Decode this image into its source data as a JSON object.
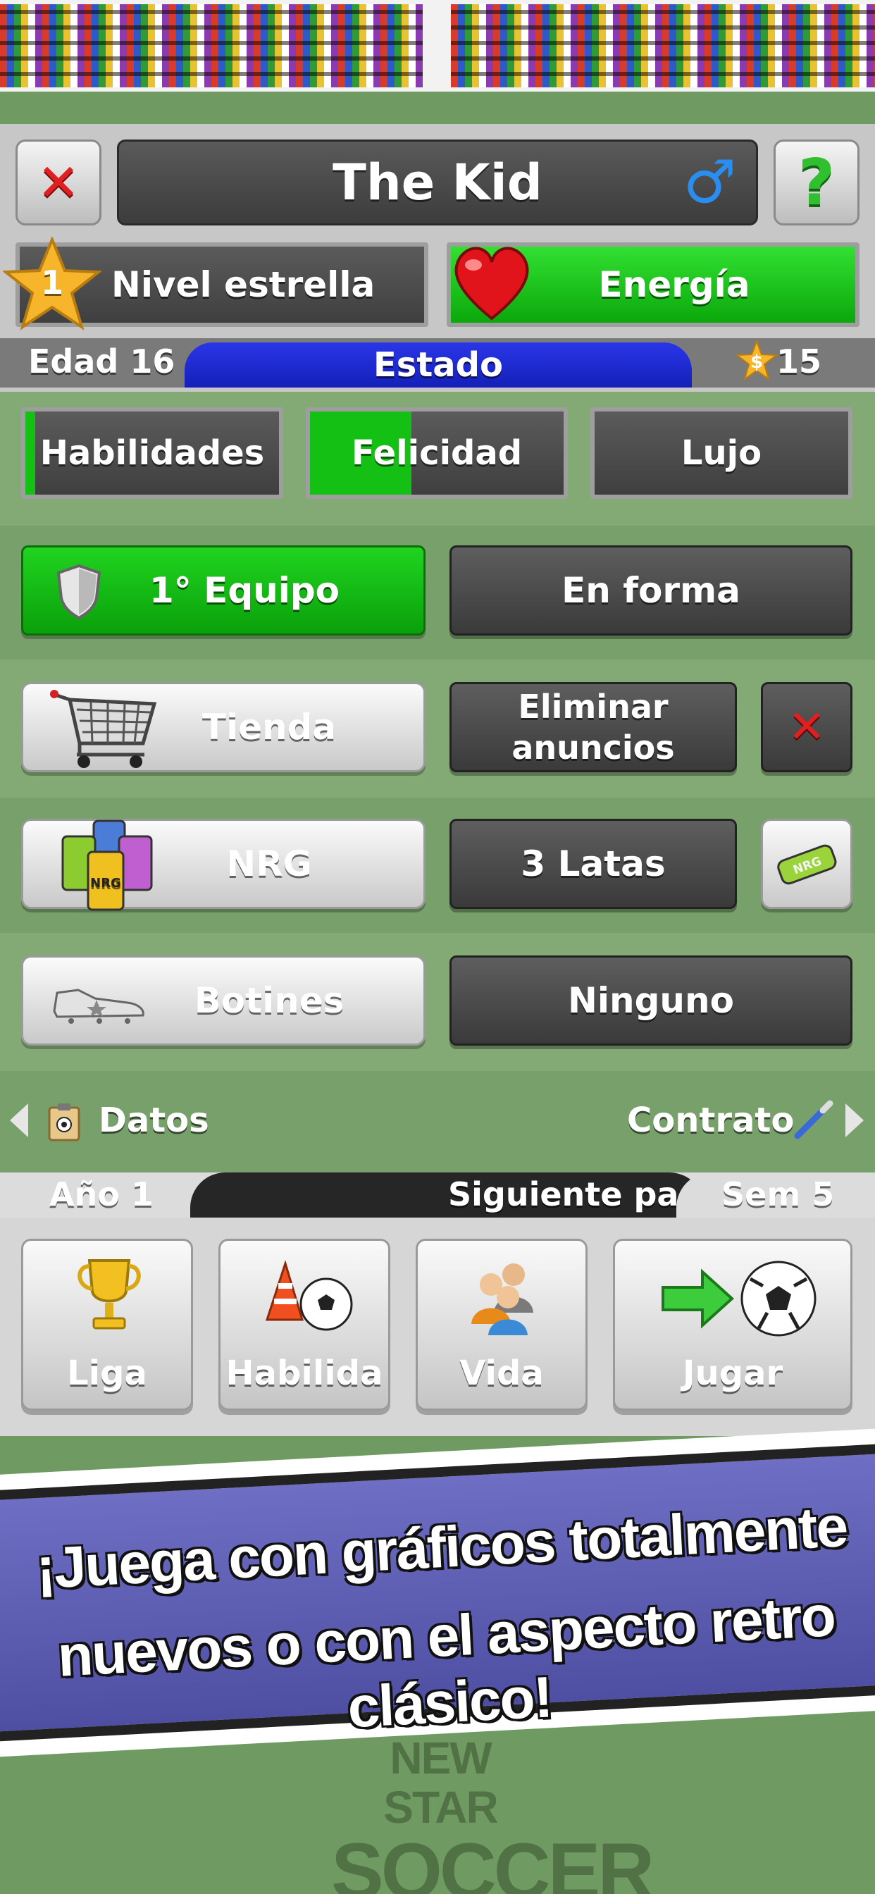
{
  "header": {
    "player_name": "The Kid",
    "close_icon": "close-icon",
    "gender_icon": "male-symbol-icon",
    "help_icon": "question-mark-icon",
    "help_glyph": "?",
    "gender_glyph": "♂",
    "close_glyph": "✕"
  },
  "stats": {
    "star_level_number": "1",
    "star_level_label": "Nivel estrella",
    "energy_label": "Energía",
    "energy_level": 1.0
  },
  "status_bar": {
    "age_label": "Edad 16",
    "title": "Estado",
    "money": "15",
    "money_icon": "star-dollar-icon"
  },
  "meters": [
    {
      "label": "Habilidades",
      "fill": 0.04
    },
    {
      "label": "Felicidad",
      "fill": 0.4
    },
    {
      "label": "Lujo",
      "fill": 0
    }
  ],
  "team": {
    "team_label": "1° Equipo",
    "form_label": "En forma"
  },
  "shop": {
    "shop_label": "Tienda",
    "remove_ads_line1": "Eliminar",
    "remove_ads_line2": "anuncios"
  },
  "nrg": {
    "nrg_label": "NRG",
    "cans_label": "3 Latas",
    "can_icon_text": "NRG"
  },
  "boots": {
    "boots_label": "Botines",
    "boots_value": "Ninguno"
  },
  "links": {
    "data_label": "Datos",
    "contract_label": "Contrato"
  },
  "timeline": {
    "year_label": "Año 1",
    "next_match_label": "Siguiente par",
    "week_label": "Sem 5"
  },
  "nav": [
    {
      "label": "Liga",
      "icon": "trophy-icon"
    },
    {
      "label": "Habilida",
      "icon": "training-cone-ball-icon"
    },
    {
      "label": "Vida",
      "icon": "people-icon"
    },
    {
      "label": "Jugar",
      "icon": "arrow-ball-icon"
    }
  ],
  "banner": {
    "line1": "¡Juega con gráficos totalmente",
    "line2": "nuevos o con el aspecto retro clásico!"
  },
  "logo": {
    "line1": "NEW STAR",
    "line2": "SOCCER"
  },
  "colors": {
    "green": "#12b812",
    "blue": "#1e2ad8",
    "red": "#e02020",
    "field": "#6f9a62"
  }
}
